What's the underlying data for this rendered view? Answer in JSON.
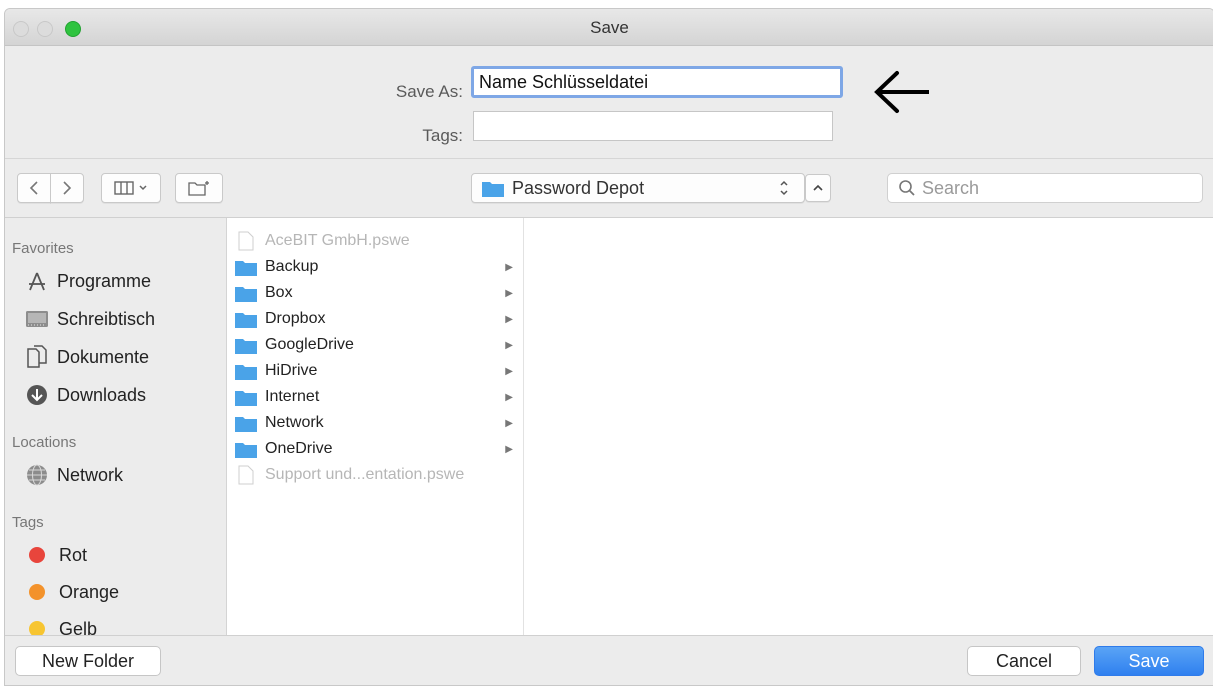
{
  "window": {
    "title": "Save"
  },
  "form": {
    "save_as_label": "Save As:",
    "save_as_value": "Name Schlüsseldatei",
    "tags_label": "Tags:",
    "tags_value": ""
  },
  "toolbar": {
    "location": "Password Depot",
    "search_placeholder": "Search"
  },
  "sidebar": {
    "favorites_header": "Favorites",
    "favorites": [
      {
        "label": "Programme",
        "icon": "apps-icon"
      },
      {
        "label": "Schreibtisch",
        "icon": "desktop-icon"
      },
      {
        "label": "Dokumente",
        "icon": "documents-icon"
      },
      {
        "label": "Downloads",
        "icon": "downloads-icon"
      }
    ],
    "locations_header": "Locations",
    "locations": [
      {
        "label": "Network",
        "icon": "network-globe-icon"
      }
    ],
    "tags_header": "Tags",
    "tags": [
      {
        "label": "Rot",
        "color": "#e8453c"
      },
      {
        "label": "Orange",
        "color": "#f3922b"
      },
      {
        "label": "Gelb",
        "color": "#f7c531"
      }
    ]
  },
  "files": [
    {
      "name": "AceBIT GmbH.pswe",
      "type": "file",
      "dim": true
    },
    {
      "name": "Backup",
      "type": "folder"
    },
    {
      "name": "Box",
      "type": "folder"
    },
    {
      "name": "Dropbox",
      "type": "folder"
    },
    {
      "name": "GoogleDrive",
      "type": "folder"
    },
    {
      "name": "HiDrive",
      "type": "folder"
    },
    {
      "name": "Internet",
      "type": "folder"
    },
    {
      "name": "Network",
      "type": "folder"
    },
    {
      "name": "OneDrive",
      "type": "folder"
    },
    {
      "name": "Support und...entation.pswe",
      "type": "file",
      "dim": true
    }
  ],
  "buttons": {
    "new_folder": "New Folder",
    "cancel": "Cancel",
    "save": "Save"
  },
  "colors": {
    "accent": "#2f80ef",
    "folder": "#4aa3e8",
    "focus_ring": "#7ea7e6"
  }
}
